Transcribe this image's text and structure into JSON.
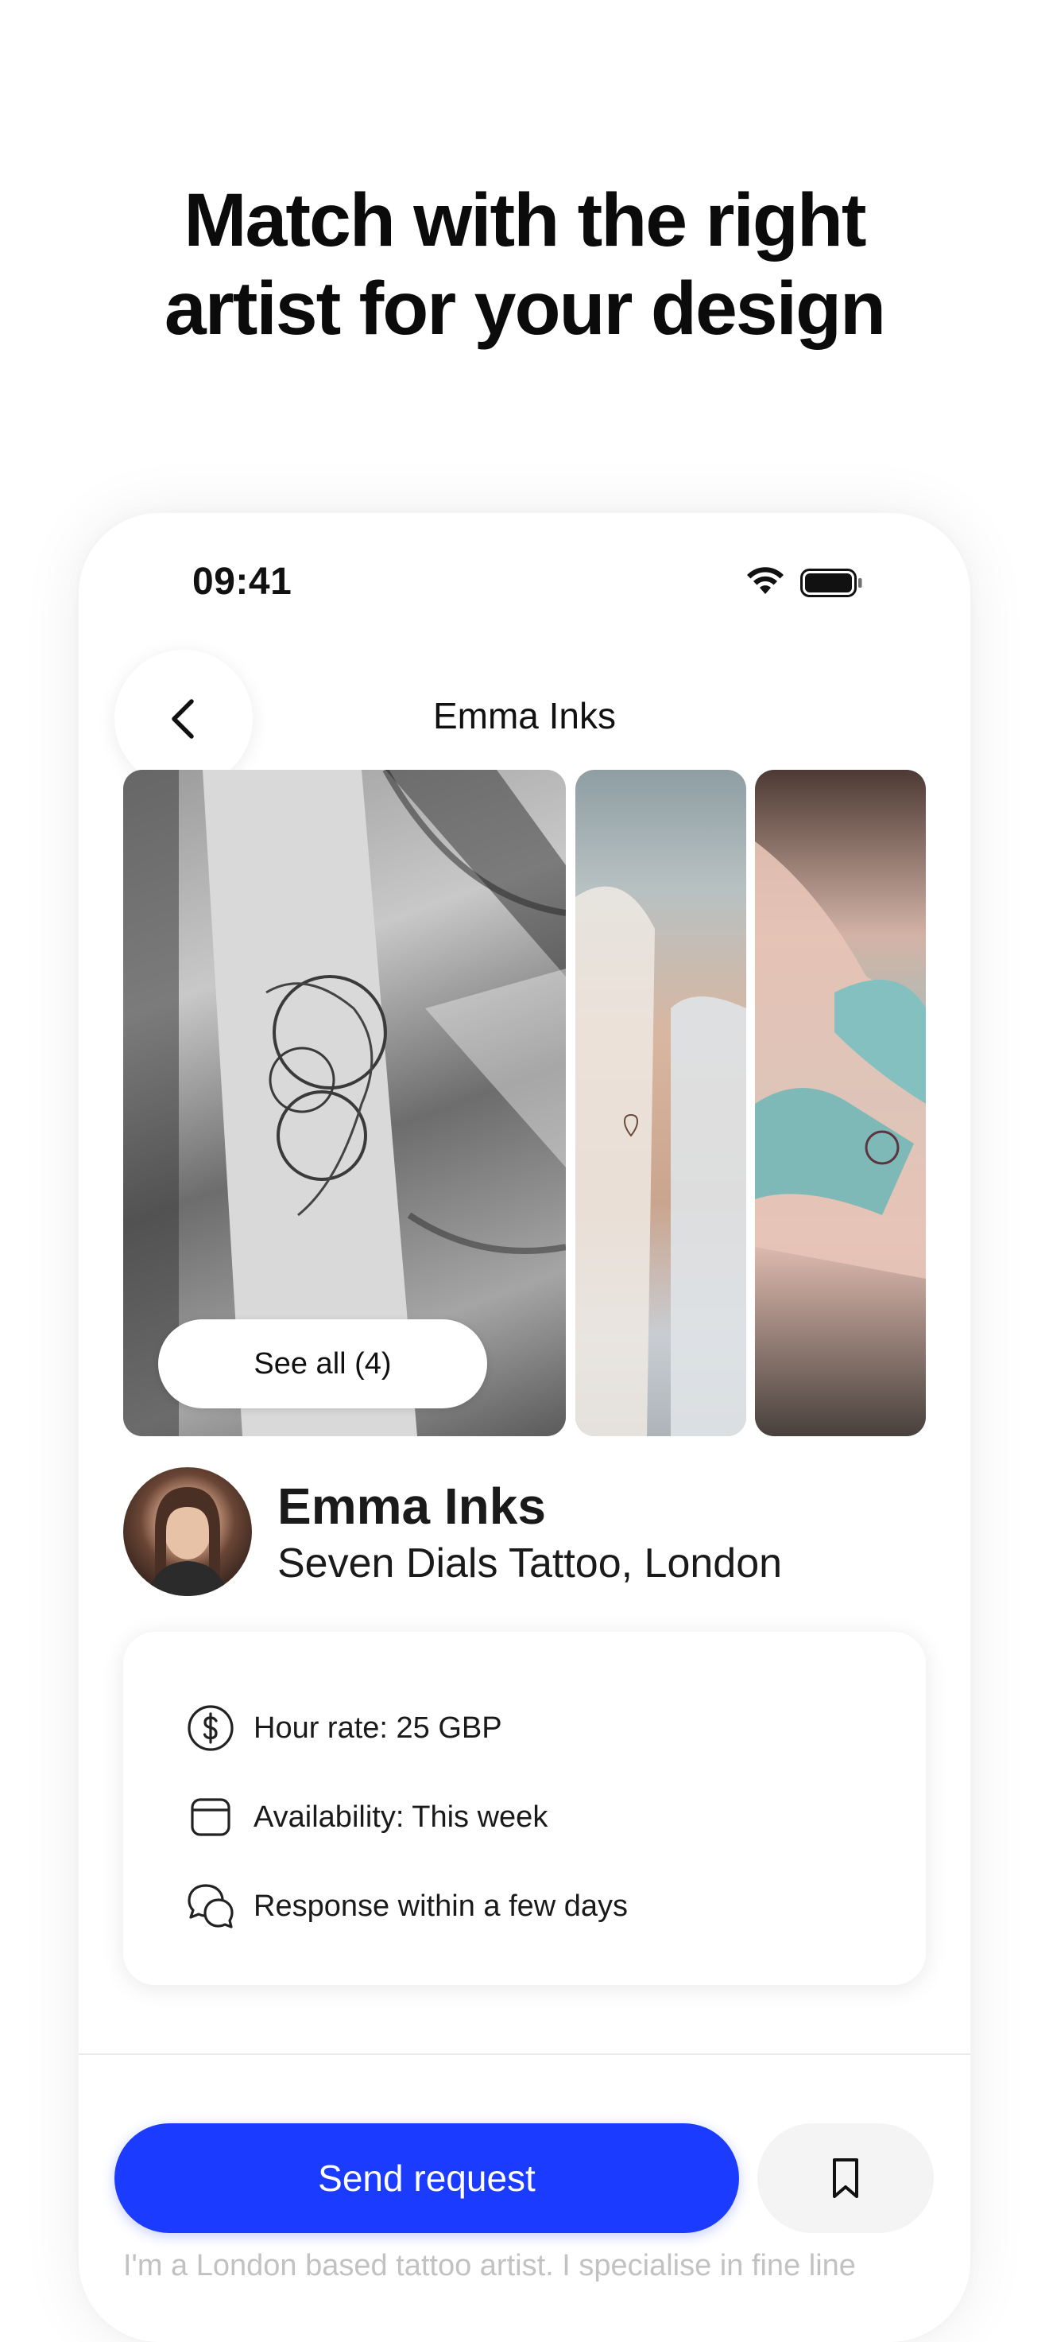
{
  "headline": {
    "line1": "Match with the right",
    "line2": "artist for your design"
  },
  "status_bar": {
    "time": "09:41",
    "wifi_icon": "wifi-icon",
    "battery_icon": "battery-icon"
  },
  "nav": {
    "back_icon": "chevron-left-icon",
    "title": "Emma Inks"
  },
  "gallery": {
    "see_all_label": "See all (4)"
  },
  "artist": {
    "name": "Emma Inks",
    "studio": "Seven Dials Tattoo, London"
  },
  "info": [
    {
      "icon": "dollar-circle-icon",
      "text": "Hour rate: 25 GBP"
    },
    {
      "icon": "calendar-icon",
      "text": "Availability: This week"
    },
    {
      "icon": "chat-bubbles-icon",
      "text": "Response within a few days"
    }
  ],
  "actions": {
    "send_request_label": "Send request",
    "bookmark_icon": "bookmark-icon"
  },
  "bio": {
    "text": "I'm a London based tattoo artist. I specialise in fine line"
  },
  "colors": {
    "accent": "#1b3cff",
    "text": "#111111",
    "muted": "#c2c2c2"
  }
}
